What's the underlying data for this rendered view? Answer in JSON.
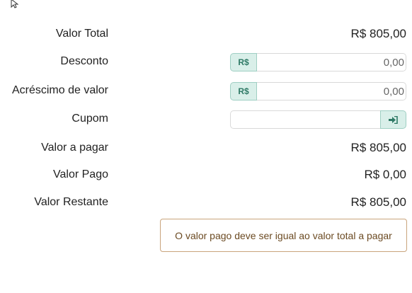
{
  "summary": {
    "total_label": "Valor Total",
    "total_value": "R$ 805,00",
    "discount_label": "Desconto",
    "discount_addon": "R$",
    "discount_placeholder": "0,00",
    "surcharge_label": "Acréscimo de valor",
    "surcharge_addon": "R$",
    "surcharge_placeholder": "0,00",
    "coupon_label": "Cupom",
    "coupon_value": "",
    "to_pay_label": "Valor a pagar",
    "to_pay_value": "R$ 805,00",
    "paid_label": "Valor Pago",
    "paid_value": "R$ 0,00",
    "remaining_label": "Valor Restante",
    "remaining_value": "R$ 805,00"
  },
  "alert": {
    "message": "O valor pago deve ser igual ao valor total a pagar"
  },
  "icons": {
    "coupon_submit": "sign-in-icon",
    "cursor": "mouse-pointer-icon"
  },
  "colors": {
    "addon_bg": "#d9efe9",
    "addon_border": "#9fcfc3",
    "addon_text": "#2f7a66",
    "alert_border": "#c9a47c",
    "alert_text": "#6b4a22"
  }
}
